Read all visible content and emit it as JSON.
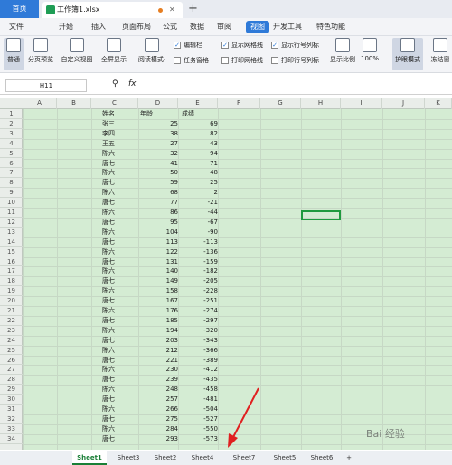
{
  "tabbar": {
    "home": "首页",
    "doc_title": "工作簿1.xlsx",
    "new_tab": "+"
  },
  "menubar": {
    "items": [
      "文件",
      "开始",
      "插入",
      "页面布局",
      "公式",
      "数据",
      "审阅",
      "视图",
      "开发工具",
      "特色功能"
    ],
    "active": "视图"
  },
  "ribbon": {
    "buttons": [
      "普通",
      "分页预览",
      "自定义视图",
      "全屏显示",
      "阅读模式·",
      "显示比例",
      "100%",
      "护眼模式",
      "冻结窗"
    ],
    "checks": [
      {
        "label": "编辑栏",
        "checked": true
      },
      {
        "label": "显示网格线",
        "checked": true
      },
      {
        "label": "显示行号列标",
        "checked": true
      },
      {
        "label": "任务窗格",
        "checked": false
      },
      {
        "label": "打印网格线",
        "checked": false
      },
      {
        "label": "打印行号列标",
        "checked": false
      }
    ]
  },
  "formula_bar": {
    "name_box": "H11",
    "fx": "fx"
  },
  "columns": [
    "A",
    "B",
    "C",
    "D",
    "E",
    "F",
    "G",
    "H",
    "I",
    "J",
    "K"
  ],
  "header_row": {
    "name": "姓名",
    "age": "年龄",
    "score": "成绩"
  },
  "rows": [
    {
      "name": "张三",
      "age": "25",
      "score": "69"
    },
    {
      "name": "李四",
      "age": "38",
      "score": "82"
    },
    {
      "name": "王五",
      "age": "27",
      "score": "43"
    },
    {
      "name": "陈六",
      "age": "32",
      "score": "94"
    },
    {
      "name": "唐七",
      "age": "41",
      "score": "71"
    },
    {
      "name": "陈六",
      "age": "50",
      "score": "48"
    },
    {
      "name": "唐七",
      "age": "59",
      "score": "25"
    },
    {
      "name": "陈六",
      "age": "68",
      "score": "2"
    },
    {
      "name": "唐七",
      "age": "77",
      "score": "-21"
    },
    {
      "name": "陈六",
      "age": "86",
      "score": "-44"
    },
    {
      "name": "唐七",
      "age": "95",
      "score": "-67"
    },
    {
      "name": "陈六",
      "age": "104",
      "score": "-90"
    },
    {
      "name": "唐七",
      "age": "113",
      "score": "-113"
    },
    {
      "name": "陈六",
      "age": "122",
      "score": "-136"
    },
    {
      "name": "唐七",
      "age": "131",
      "score": "-159"
    },
    {
      "name": "陈六",
      "age": "140",
      "score": "-182"
    },
    {
      "name": "唐七",
      "age": "149",
      "score": "-205"
    },
    {
      "name": "陈六",
      "age": "158",
      "score": "-228"
    },
    {
      "name": "唐七",
      "age": "167",
      "score": "-251"
    },
    {
      "name": "陈六",
      "age": "176",
      "score": "-274"
    },
    {
      "name": "唐七",
      "age": "185",
      "score": "-297"
    },
    {
      "name": "陈六",
      "age": "194",
      "score": "-320"
    },
    {
      "name": "唐七",
      "age": "203",
      "score": "-343"
    },
    {
      "name": "陈六",
      "age": "212",
      "score": "-366"
    },
    {
      "name": "唐七",
      "age": "221",
      "score": "-389"
    },
    {
      "name": "陈六",
      "age": "230",
      "score": "-412"
    },
    {
      "name": "唐七",
      "age": "239",
      "score": "-435"
    },
    {
      "name": "陈六",
      "age": "248",
      "score": "-458"
    },
    {
      "name": "唐七",
      "age": "257",
      "score": "-481"
    },
    {
      "name": "陈六",
      "age": "266",
      "score": "-504"
    },
    {
      "name": "唐七",
      "age": "275",
      "score": "-527"
    },
    {
      "name": "陈六",
      "age": "284",
      "score": "-550"
    },
    {
      "name": "唐七",
      "age": "293",
      "score": "-573"
    }
  ],
  "sheets": [
    "Sheet1",
    "Sheet3",
    "Sheet2",
    "Sheet4",
    "Sheet7",
    "Sheet5",
    "Sheet6",
    "+"
  ],
  "active_sheet": "Sheet1",
  "watermark": "Bai 经验"
}
